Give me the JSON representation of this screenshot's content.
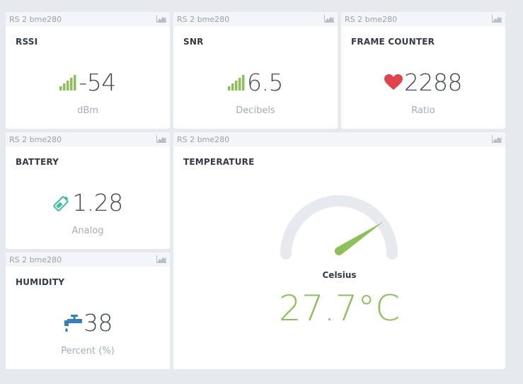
{
  "widgets": {
    "rssi": {
      "source": "RS 2 bme280",
      "title": "RSSI",
      "value": "-54",
      "unit": "dBm",
      "icon": "signal-bars-icon"
    },
    "snr": {
      "source": "RS 2 bme280",
      "title": "SNR",
      "value": "6.5",
      "unit": "Decibels",
      "icon": "signal-bars-icon"
    },
    "frame_counter": {
      "source": "RS 2 bme280",
      "title": "FRAME COUNTER",
      "value": "2288",
      "unit": "Ratio",
      "icon": "heart-icon"
    },
    "battery": {
      "source": "RS 2 bme280",
      "title": "BATTERY",
      "value": "1.28",
      "unit": "Analog",
      "icon": "battery-icon"
    },
    "humidity": {
      "source": "RS 2 bme280",
      "title": "HUMIDITY",
      "value": "38",
      "unit": "Percent (%)",
      "icon": "faucet-icon"
    },
    "temperature": {
      "source": "RS 2 bme280",
      "title": "TEMPERATURE",
      "gauge_label": "Celsius",
      "value": "27.7°C",
      "gauge_level": 0.8
    }
  },
  "colors": {
    "background": "#e6e9ee",
    "card": "#ffffff",
    "header": "#f3f5f8",
    "accent_green": "#8bc157",
    "heart_red": "#e2434b",
    "battery_teal": "#3bbf9e",
    "faucet_blue": "#2f7fc1",
    "gauge_track": "#e6e9ee"
  }
}
